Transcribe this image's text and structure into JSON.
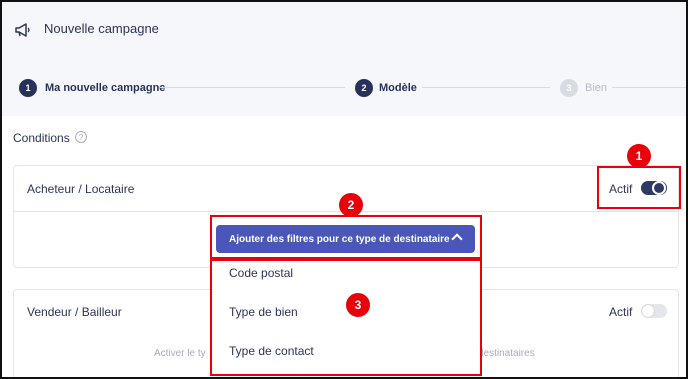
{
  "header": {
    "title": "Nouvelle campagne",
    "icon": "megaphone-icon"
  },
  "stepper": [
    {
      "number": "1",
      "label": "Ma nouvelle campagne",
      "state": "done"
    },
    {
      "number": "2",
      "label": "Modèle",
      "state": "active"
    },
    {
      "number": "3",
      "label": "Bien",
      "state": "disabled"
    }
  ],
  "conditions": {
    "title": "Conditions",
    "help": "?"
  },
  "cards": [
    {
      "title": "Acheteur / Locataire",
      "status_label": "Actif",
      "enabled": true
    },
    {
      "title": "Vendeur / Bailleur",
      "status_label": "Actif",
      "enabled": false,
      "hint_left": "Activer le ty",
      "hint_right": "destinataires"
    }
  ],
  "filter_button": {
    "label": "Ajouter des filtres pour ce type de destinataire"
  },
  "dropdown": {
    "items": [
      "Code postal",
      "Type de bien",
      "Type de contact"
    ]
  },
  "annotations": {
    "badges": [
      "1",
      "2",
      "3"
    ],
    "color": "#e8000b"
  },
  "colors": {
    "primary_dark": "#2e3a64",
    "button": "#4a57b8",
    "background": "#f6f7fb"
  }
}
